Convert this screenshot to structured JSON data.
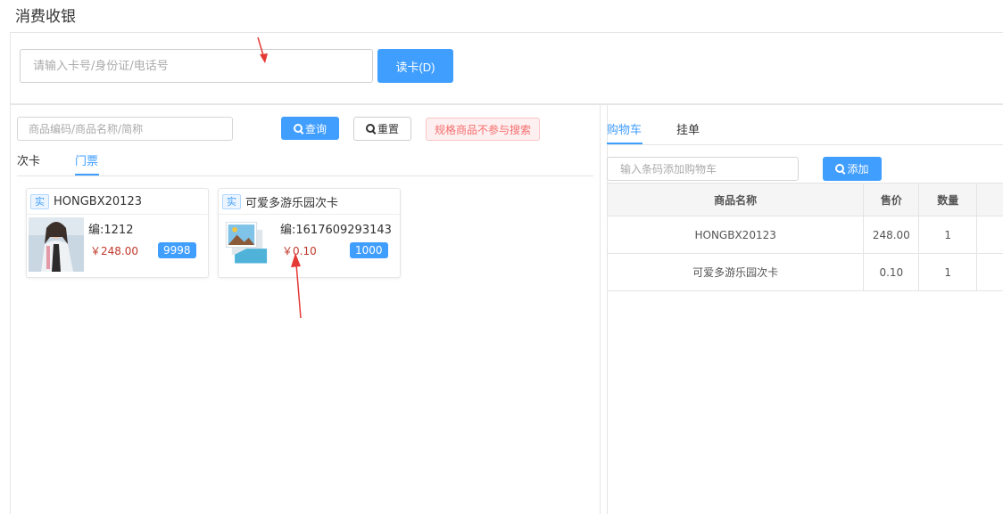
{
  "page": {
    "title": "消费收银"
  },
  "card_reader": {
    "placeholder": "请输入卡号/身份证/电话号",
    "read_button": "读卡(D)"
  },
  "product_search": {
    "placeholder": "商品编码/商品名称/简称",
    "query_button": "查询",
    "reset_button": "重置",
    "spec_note": "规格商品不参与搜索"
  },
  "left_tabs": [
    {
      "label": "次卡",
      "active": false
    },
    {
      "label": "门票",
      "active": true
    }
  ],
  "products": [
    {
      "tag": "实",
      "name": "HONGBX20123",
      "code": "编:1212",
      "price": "￥248.00",
      "stock": "9998",
      "image": "person-photo"
    },
    {
      "tag": "实",
      "name": "可爱多游乐园次卡",
      "code": "编:1617609293143",
      "price": "￥0.10",
      "stock": "1000",
      "image": "placeholder-picture-icon"
    }
  ],
  "right_tabs": [
    {
      "label": "购物车",
      "active": true
    },
    {
      "label": "挂单",
      "active": false
    }
  ],
  "cart": {
    "add_placeholder": "输入条码添加购物车",
    "add_button": "添加",
    "columns": [
      "商品名称",
      "售价",
      "数量"
    ],
    "rows": [
      {
        "name": "HONGBX20123",
        "price": "248.00",
        "qty": "1"
      },
      {
        "name": "可爱多游乐园次卡",
        "price": "0.10",
        "qty": "1"
      }
    ]
  },
  "colors": {
    "primary": "#409eff",
    "danger": "#f56c6c",
    "annotation_arrow": "#e53935"
  }
}
